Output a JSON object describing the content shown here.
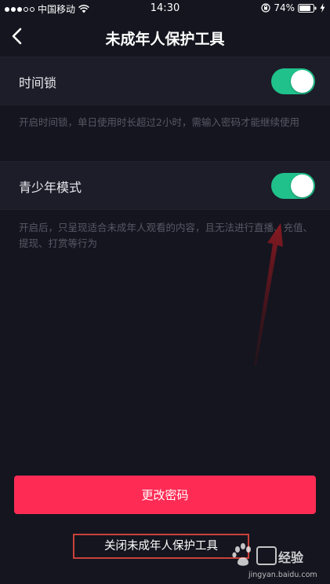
{
  "status_bar": {
    "carrier": "中国移动",
    "time": "14:30",
    "battery": "74%"
  },
  "nav": {
    "title": "未成年人保护工具"
  },
  "settings": {
    "time_lock": {
      "label": "时间锁",
      "enabled": true,
      "description": "开启时间锁，单日使用时长超过2小时，需输入密码才能继续使用"
    },
    "youth_mode": {
      "label": "青少年模式",
      "enabled": true,
      "description": "开启后，只呈现适合未成年人观看的内容，且无法进行直播、充值、提现、打赏等行为"
    }
  },
  "actions": {
    "change_password": "更改密码",
    "close_tool": "关闭未成年人保护工具"
  },
  "watermark": {
    "word": "经验",
    "url": "jingyan.baidu.com"
  },
  "colors": {
    "background": "#15151f",
    "row_background": "#1d1d29",
    "toggle_on": "#20c18b",
    "primary_button": "#fe2c55",
    "annotation": "#c8423a"
  }
}
